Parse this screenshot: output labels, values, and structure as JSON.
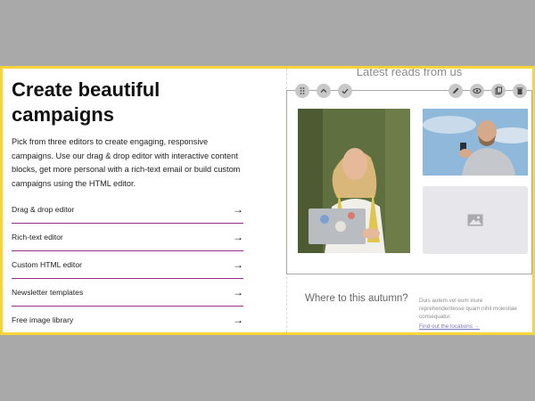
{
  "hero": {
    "title": "Create beautiful campaigns",
    "description": "Pick from three editors to create engaging, responsive campaigns. Use our drag & drop editor with interactive content blocks, get more personal with a rich-text email or build custom campaigns using the HTML editor."
  },
  "features": [
    {
      "label": "Drag & drop editor",
      "arrow": "→"
    },
    {
      "label": "Rich-text editor",
      "arrow": "→"
    },
    {
      "label": "Custom HTML editor",
      "arrow": "→"
    },
    {
      "label": "Newsletter templates",
      "arrow": "→"
    },
    {
      "label": "Free image library",
      "arrow": "→"
    }
  ],
  "preview": {
    "section_title": "Latest reads from us",
    "toolbar_left": [
      "drag-handle-icon",
      "chevron-up-icon",
      "check-icon"
    ],
    "toolbar_right": [
      "pencil-icon",
      "eye-icon",
      "duplicate-icon",
      "trash-icon"
    ],
    "placeholder_icon": "image-icon",
    "article": {
      "title": "Where to this autumn?",
      "text": "Duis autem vel eum iriure reprehenderitesse quam nihil molestiae consequatur.",
      "link": "Find out the locations →"
    }
  },
  "colors": {
    "frame_border": "#f7d438",
    "feature_divider": "#9a2b8f",
    "toolbar_button": "#c8c8c8",
    "backdrop": "#a9a9a9"
  }
}
